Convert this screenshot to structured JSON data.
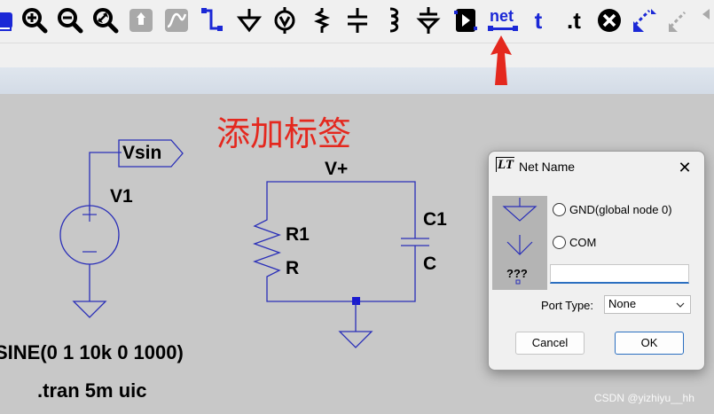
{
  "toolbar": {
    "net_label": "net",
    "t_label": "t",
    "dot_t_label": ".t"
  },
  "annotation": {
    "text": "添加标签",
    "color": "#e4281e"
  },
  "schematic": {
    "vsin_label": "Vsin",
    "v1_label": "V1",
    "vplus_label": "V+",
    "r1_label": "R1",
    "r_label": "R",
    "c1_label": "C1",
    "c_label": "C",
    "sine_directive": "SINE(0 1 10k 0 1000)",
    "tran_directive": ".tran 5m uic",
    "wire_color": "#2a2fb8",
    "node_color": "#1a1ad0"
  },
  "dialog": {
    "logo_text": "LT",
    "title": "Net Name",
    "close_glyph": "✕",
    "options": [
      {
        "label": "GND(global node 0)"
      },
      {
        "label": "COM"
      }
    ],
    "unnamed_label": "???",
    "name_value": "",
    "port_type_label": "Port Type:",
    "port_type_value": "None",
    "cancel_label": "Cancel",
    "ok_label": "OK"
  },
  "watermark": "CSDN @yizhiyu__hh"
}
